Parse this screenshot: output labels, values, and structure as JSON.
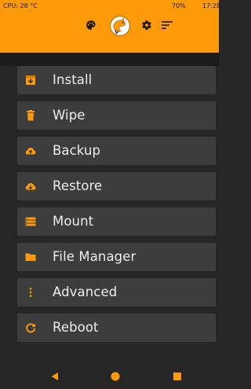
{
  "status_bar": {
    "cpu_text": "CPU: 28 °C",
    "battery_text": "70%",
    "time_text": "17:28"
  },
  "header": {
    "icons": [
      "palette-icon",
      "twrp-logo",
      "gear-icon",
      "sort-icon"
    ],
    "accent_color": "#ff9b0a"
  },
  "menu": {
    "items": [
      {
        "label": "Install",
        "icon": "install-icon"
      },
      {
        "label": "Wipe",
        "icon": "trash-icon"
      },
      {
        "label": "Backup",
        "icon": "cloud-upload-icon"
      },
      {
        "label": "Restore",
        "icon": "cloud-download-icon"
      },
      {
        "label": "Mount",
        "icon": "storage-icon"
      },
      {
        "label": "File Manager",
        "icon": "folder-icon"
      },
      {
        "label": "Advanced",
        "icon": "more-vertical-icon"
      },
      {
        "label": "Reboot",
        "icon": "reboot-icon"
      }
    ]
  },
  "nav_bar": {
    "buttons": [
      "back",
      "home",
      "recents"
    ]
  }
}
